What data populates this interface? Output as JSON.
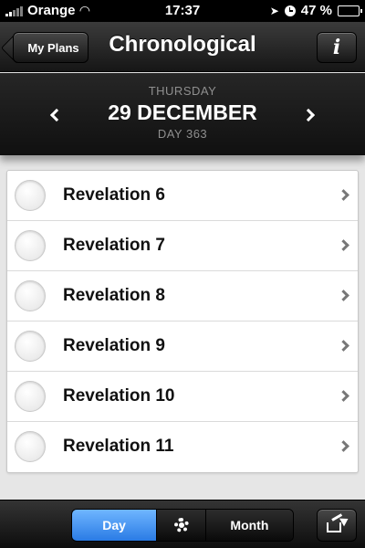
{
  "status_bar": {
    "carrier": "Orange",
    "time": "17:37",
    "battery": "47 %",
    "battery_level": 0.47
  },
  "nav": {
    "back_label": "My Plans",
    "title": "Chronological",
    "info_label": "i"
  },
  "date": {
    "weekday": "THURSDAY",
    "date": "29 DECEMBER",
    "day": "DAY 363"
  },
  "readings": [
    {
      "label": "Revelation 6"
    },
    {
      "label": "Revelation 7"
    },
    {
      "label": "Revelation 8"
    },
    {
      "label": "Revelation 9"
    },
    {
      "label": "Revelation 10"
    },
    {
      "label": "Revelation 11"
    }
  ],
  "toolbar": {
    "day_label": "Day",
    "month_label": "Month",
    "accent": "#3d8ef0"
  }
}
